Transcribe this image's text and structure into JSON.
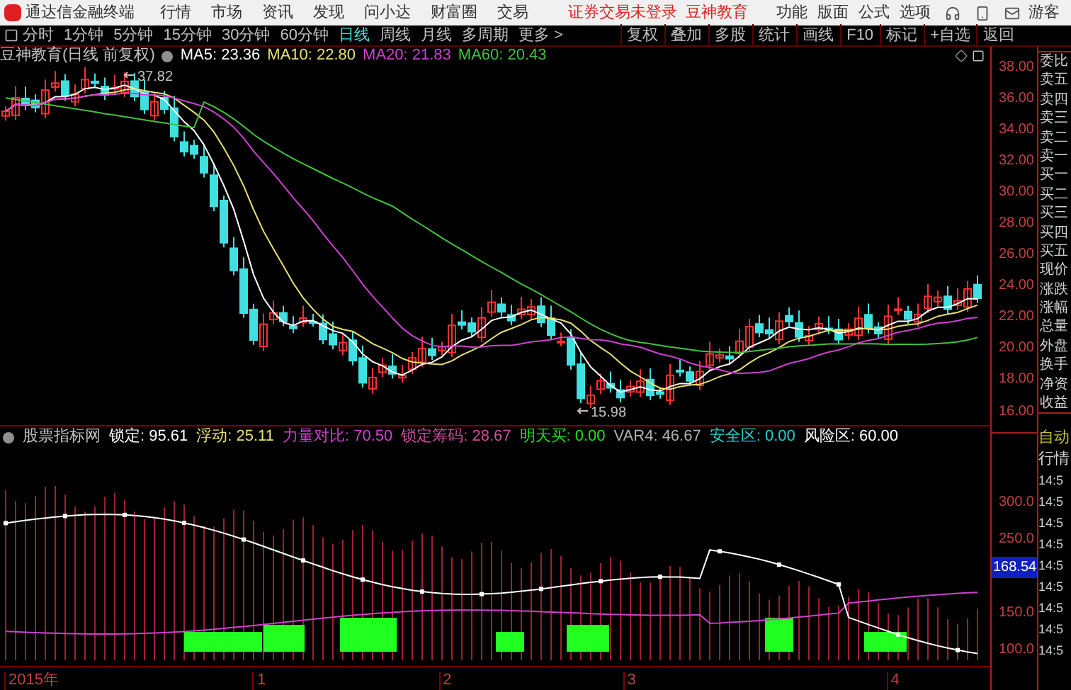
{
  "app_title": "通达信金融终端",
  "menu": [
    "行情",
    "市场",
    "资讯",
    "发现",
    "问小达",
    "财富圈",
    "交易"
  ],
  "login_status": "证券交易未登录",
  "brand": "豆神教育",
  "right_menu": [
    "功能",
    "版面",
    "公式",
    "选项"
  ],
  "user": "游客",
  "periods": [
    {
      "label": "分时",
      "selected": false
    },
    {
      "label": "1分钟",
      "selected": false
    },
    {
      "label": "5分钟",
      "selected": false
    },
    {
      "label": "15分钟",
      "selected": false
    },
    {
      "label": "30分钟",
      "selected": false
    },
    {
      "label": "60分钟",
      "selected": false
    },
    {
      "label": "日线",
      "selected": true
    },
    {
      "label": "周线",
      "selected": false
    },
    {
      "label": "月线",
      "selected": false
    },
    {
      "label": "多周期",
      "selected": false
    },
    {
      "label": "更多 >",
      "selected": false
    }
  ],
  "tools": [
    "复权",
    "叠加",
    "多股",
    "统计",
    "画线",
    "F10",
    "标记",
    "+自选",
    "返回"
  ],
  "chart": {
    "title": "豆神教育(日线 前复权)",
    "ma": [
      {
        "label": "MA5: 23.36",
        "color": "#ffffff"
      },
      {
        "label": "MA10: 22.80",
        "color": "#e8e070"
      },
      {
        "label": "MA20: 21.83",
        "color": "#d040d0"
      },
      {
        "label": "MA60: 20.43",
        "color": "#40c040"
      }
    ],
    "high_label": "37.82",
    "low_label": "15.98",
    "price_ticks": [
      "38.00",
      "36.00",
      "34.00",
      "32.00",
      "30.00",
      "28.00",
      "26.00",
      "24.00",
      "22.00",
      "20.00",
      "18.00",
      "16.00"
    ]
  },
  "indicator": {
    "name": "股票指标网",
    "values": [
      {
        "label": "锁定: 95.61",
        "color": "#ffffff"
      },
      {
        "label": "浮动: 25.11",
        "color": "#e8e070"
      },
      {
        "label": "力量对比: 70.50",
        "color": "#d040d0"
      },
      {
        "label": "锁定筹码: 28.67",
        "color": "#d050a0"
      },
      {
        "label": "明天买: 0.00",
        "color": "#20e020"
      },
      {
        "label": "VAR4: 46.67",
        "color": "#b0b0b0"
      },
      {
        "label": "安全区: 0.00",
        "color": "#20d0d0"
      },
      {
        "label": "风险区: 60.00",
        "color": "#ffffff"
      }
    ],
    "ticks": [
      "300.0",
      "250.0",
      "150.0",
      "100.0"
    ],
    "current": "168.54"
  },
  "dates": [
    "2015年",
    "1",
    "2",
    "3",
    "4"
  ],
  "quote_labels": [
    "委比",
    "卖五",
    "卖四",
    "卖三",
    "卖二",
    "卖一",
    "买一",
    "买二",
    "买三",
    "买四",
    "买五",
    "现价",
    "涨跌",
    "涨幅",
    "总量",
    "外盘",
    "换手",
    "净资",
    "收益"
  ],
  "auto": "自动",
  "market": "行情",
  "times": [
    "14:5",
    "14:5",
    "14:5",
    "14:5",
    "14:5",
    "14:5",
    "14:5",
    "14:5",
    "14:5"
  ]
}
